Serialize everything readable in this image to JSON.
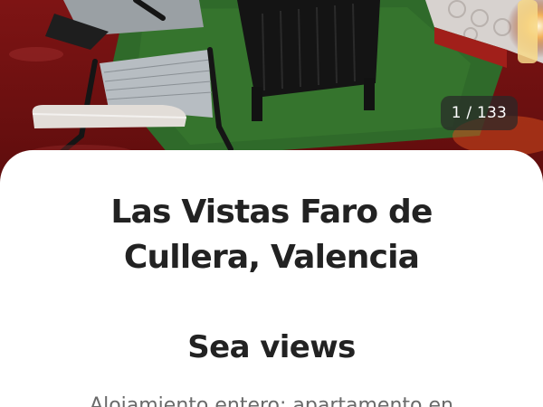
{
  "gallery": {
    "counter": "1 / 133"
  },
  "listing": {
    "title_line1": "Las Vistas Faro de",
    "title_line2": "Cullera, Valencia",
    "highlight": "Sea views",
    "property_type": "Alojamiento entero: apartamento en"
  },
  "colors": {
    "text_primary": "#222222",
    "text_secondary": "#6a6a6a",
    "counter_bg": "#282828",
    "background": "#ffffff"
  }
}
